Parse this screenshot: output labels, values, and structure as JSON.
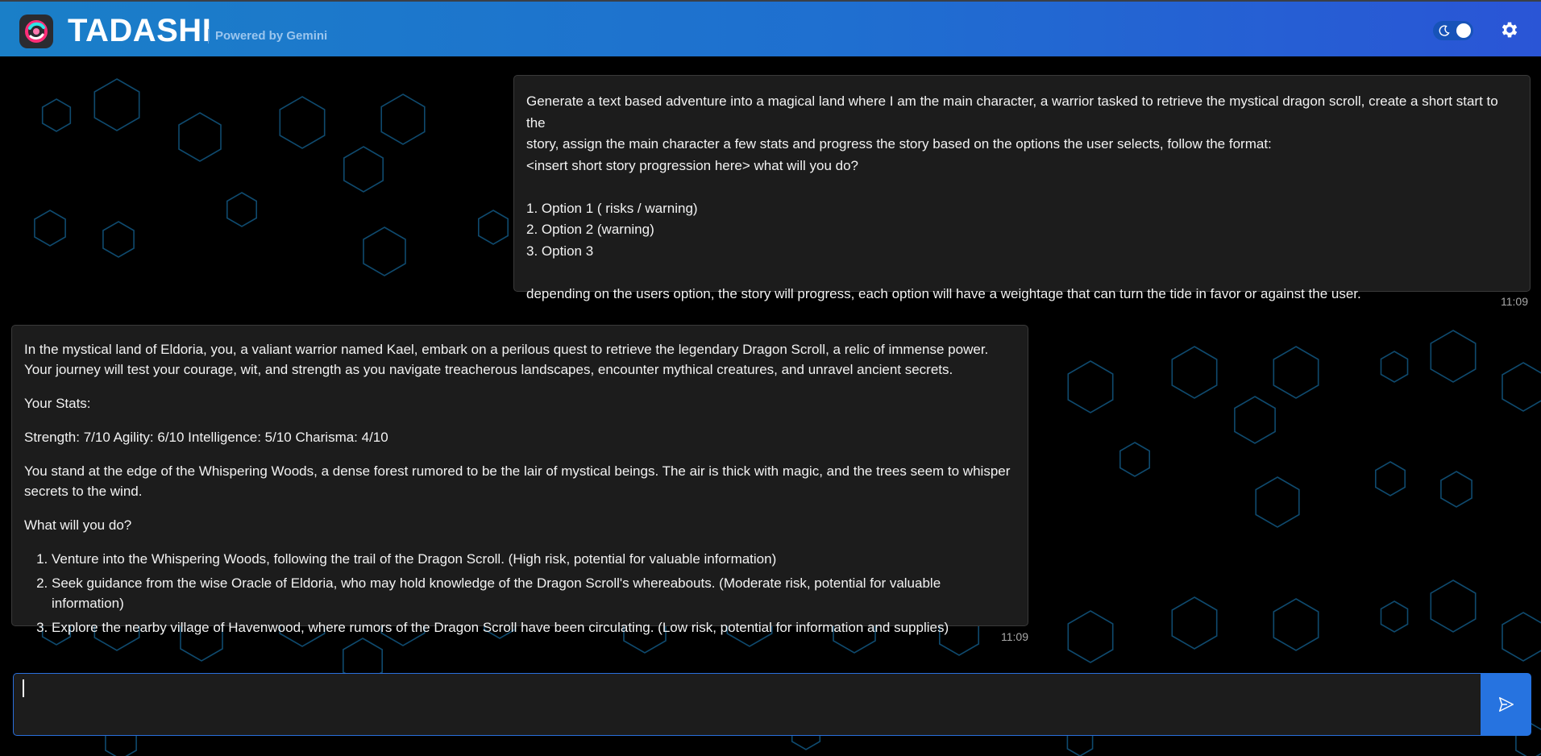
{
  "app": {
    "brand": "TADASHI",
    "powered_by": "Powered by Gemini",
    "accent_color": "#1f6fd0",
    "send_color": "#2673e0"
  },
  "header": {
    "theme_toggle_icon": "moon-icon",
    "settings_icon": "gear-icon"
  },
  "messages": {
    "user": {
      "lines": [
        "Generate a text based adventure into a magical land where I am the main character, a warrior tasked to retrieve the mystical dragon scroll, create a short start to the",
        "story, assign the main character a few stats and progress the story based on the options the user selects, follow the format:",
        "<insert short story progression here> what will you do?",
        "",
        "1. Option 1 ( risks / warning)",
        "2. Option 2 (warning)",
        "3. Option 3",
        "",
        "depending on the users option, the story will progress, each option will have a weightage that can turn the tide in favor or against the user."
      ],
      "time": "11:09"
    },
    "assistant": {
      "intro": "In the mystical land of Eldoria, you, a valiant warrior named Kael, embark on a perilous quest to retrieve the legendary Dragon Scroll, a relic of immense power. Your journey will test your courage, wit, and strength as you navigate treacherous landscapes, encounter mythical creatures, and unravel ancient secrets.",
      "stats_heading": "Your Stats:",
      "stats": "Strength: 7/10 Agility: 6/10 Intelligence: 5/10 Charisma: 4/10",
      "scene": "You stand at the edge of the Whispering Woods, a dense forest rumored to be the lair of mystical beings. The air is thick with magic, and the trees seem to whisper secrets to the wind.",
      "question": "What will you do?",
      "options": [
        "Venture into the Whispering Woods, following the trail of the Dragon Scroll. (High risk, potential for valuable information)",
        "Seek guidance from the wise Oracle of Eldoria, who may hold knowledge of the Dragon Scroll's whereabouts. (Moderate risk, potential for valuable information)",
        "Explore the nearby village of Havenwood, where rumors of the Dragon Scroll have been circulating. (Low risk, potential for information and supplies)"
      ],
      "time": "11:09"
    }
  },
  "composer": {
    "value": "",
    "placeholder": "",
    "send_icon": "send-icon"
  }
}
